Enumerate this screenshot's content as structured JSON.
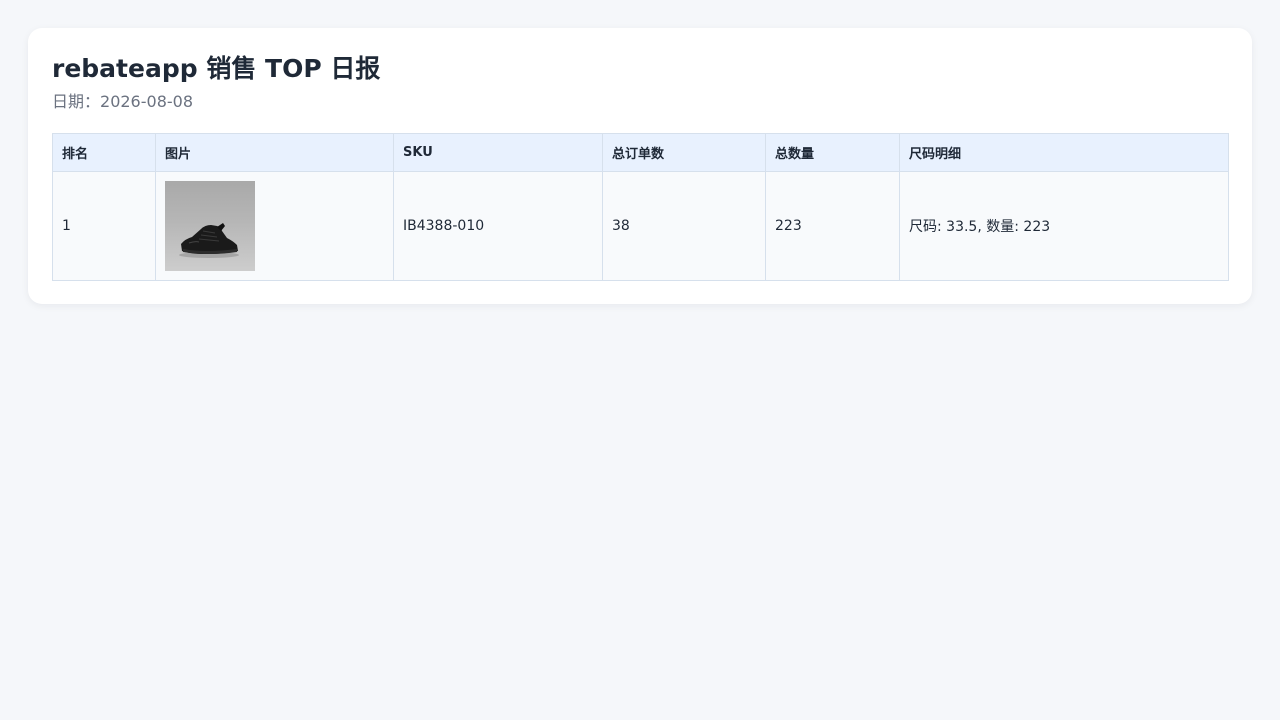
{
  "report": {
    "title": "rebateapp 销售 TOP 日报",
    "date_label": "日期：",
    "date": "2026-08-08"
  },
  "table": {
    "columns": [
      "排名",
      "图片",
      "SKU",
      "总订单数",
      "总数量",
      "尺码明细"
    ],
    "rows": [
      {
        "rank": "1",
        "image_icon": "sneaker-photo",
        "sku": "IB4388-010",
        "total_orders": "38",
        "total_quantity": "223",
        "size_detail": "尺码: 33.5, 数量: 223"
      }
    ]
  }
}
